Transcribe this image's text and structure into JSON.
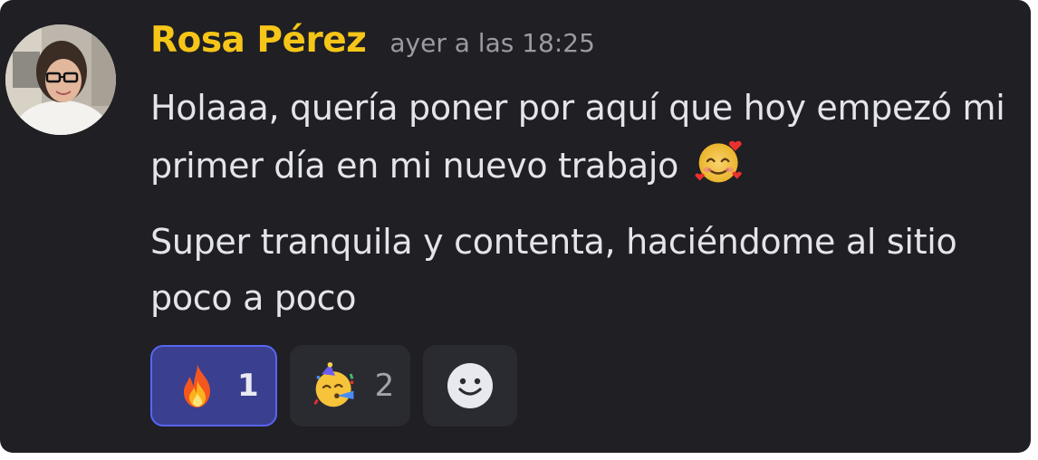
{
  "message": {
    "author": "Rosa Pérez",
    "timestamp": "ayer a las 18:25",
    "author_color": "#f5c518",
    "paragraphs": [
      "Holaaa, quería poner por aquí que hoy empezó mi primer día en mi nuevo trabajo",
      "Super tranquila y contenta, haciéndome al sitio poco a poco"
    ],
    "inline_emoji": "smiling-face-with-hearts"
  },
  "reactions": [
    {
      "emoji": "fire",
      "count": "1",
      "selected": true
    },
    {
      "emoji": "partying-face",
      "count": "2",
      "selected": false
    }
  ],
  "add_reaction": {
    "icon": "add-reaction-smiley-icon"
  },
  "colors": {
    "background": "#1f1f24",
    "text": "#e4e5e9",
    "timestamp": "#9a9ba3",
    "reaction_selected": "#3a3f8f",
    "reaction_selected_border": "#5865f2",
    "reaction_bg": "#2a2b31"
  }
}
